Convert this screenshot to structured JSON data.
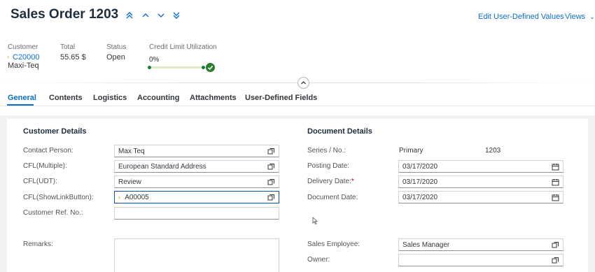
{
  "header": {
    "title": "Sales Order 1203",
    "edit_udv_label": "Edit User-Defined Values",
    "views_label": "Views"
  },
  "nav_icons": [
    "first-record-icon",
    "previous-record-icon",
    "next-record-icon",
    "last-record-icon"
  ],
  "kpis": {
    "customer": {
      "label": "Customer",
      "code": "C20000",
      "name": "Maxi-Teq"
    },
    "total": {
      "label": "Total",
      "value": "55.65 $"
    },
    "status": {
      "label": "Status",
      "value": "Open"
    },
    "credit": {
      "label": "Credit Limit Utilization",
      "value": "0%",
      "fraction": 0
    }
  },
  "tabs": [
    {
      "label": "General",
      "active": true
    },
    {
      "label": "Contents"
    },
    {
      "label": "Logistics"
    },
    {
      "label": "Accounting"
    },
    {
      "label": "Attachments"
    },
    {
      "label": "User-Defined Fields"
    }
  ],
  "customer_details": {
    "title": "Customer Details",
    "contact_person": {
      "label": "Contact Person:",
      "value": "Max Teq"
    },
    "cfl_multiple": {
      "label": "CFL(Multiple):",
      "value": "European Standard Address"
    },
    "cfl_udt": {
      "label": "CFL(UDT):",
      "value": "Review"
    },
    "cfl_showlink": {
      "label": "CFL(ShowLinkButton):",
      "value": "A00005"
    },
    "customer_ref": {
      "label": "Customer Ref. No.:",
      "value": ""
    },
    "remarks": {
      "label": "Remarks:",
      "value": ""
    }
  },
  "document_details": {
    "title": "Document Details",
    "series": {
      "label": "Series / No.:",
      "series_value": "Primary",
      "number_value": "1203"
    },
    "posting_date": {
      "label": "Posting Date:",
      "value": "03/17/2020"
    },
    "delivery_date": {
      "label": "Delivery Date:",
      "required_mark": "*",
      "value": "03/17/2020"
    },
    "document_date": {
      "label": "Document Date:",
      "value": "03/17/2020"
    },
    "sales_employee": {
      "label": "Sales Employee:",
      "value": "Sales Manager"
    },
    "owner": {
      "label": "Owner:",
      "value": ""
    }
  },
  "colors": {
    "accent": "#0a6ed1",
    "success": "#107e3e",
    "link_arrow": "#e09d00"
  }
}
